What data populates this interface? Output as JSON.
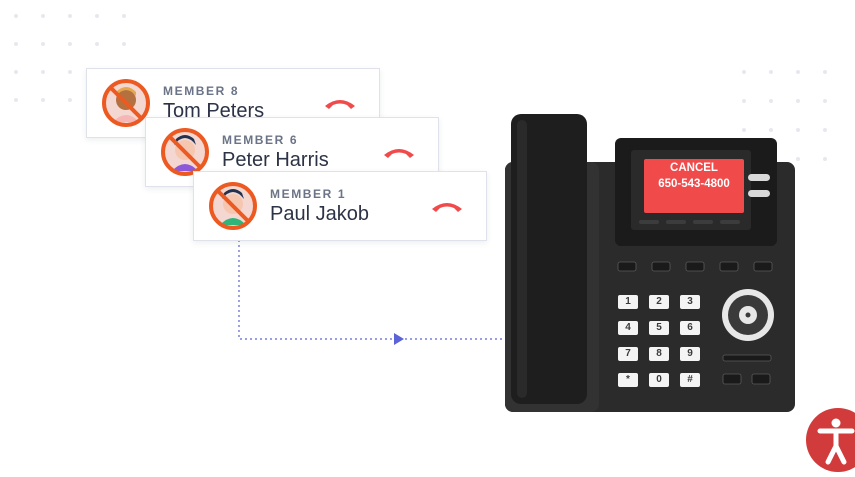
{
  "members": [
    {
      "role": "MEMBER 8",
      "name": "Tom Peters"
    },
    {
      "role": "MEMBER 6",
      "name": "Peter Harris"
    },
    {
      "role": "MEMBER 1",
      "name": "Paul Jakob"
    }
  ],
  "phone": {
    "screen_line1": "CANCEL",
    "screen_line2": "650-543-4800",
    "keys": [
      "1",
      "2",
      "3",
      "4",
      "5",
      "6",
      "7",
      "8",
      "9",
      "*",
      "0",
      "#"
    ]
  },
  "colors": {
    "accent_red": "#f04a4a",
    "forbidden_orange": "#ec5a22",
    "connector_blue": "#5b63d6",
    "phone_body": "#2b2b2b"
  },
  "icons": [
    "hangup-icon",
    "no-call-icon",
    "accessibility-icon"
  ]
}
